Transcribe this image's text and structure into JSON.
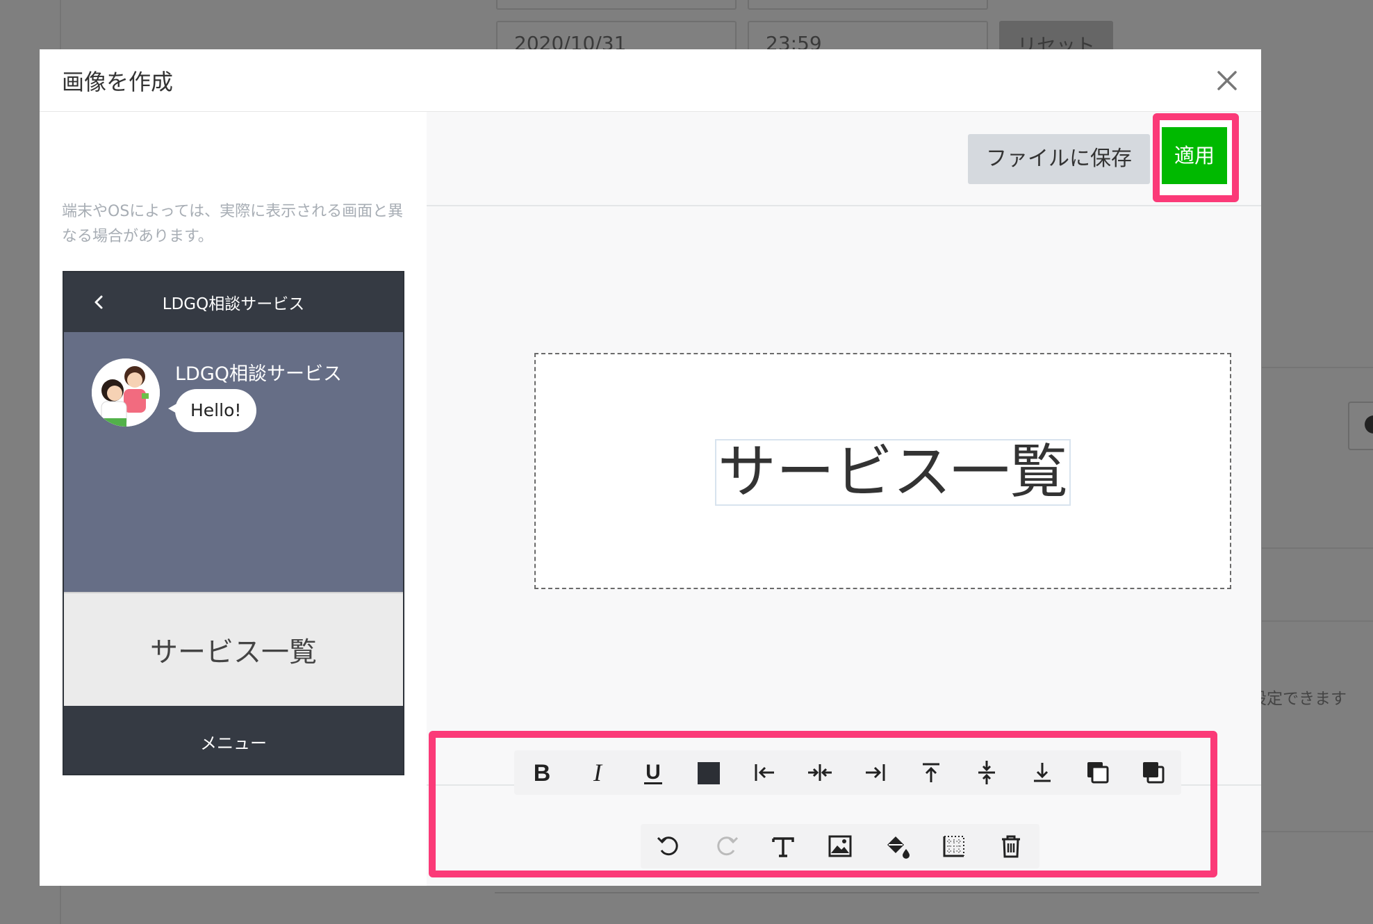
{
  "background": {
    "date_value": "2020/10/31",
    "time_value": "23:59",
    "reset_label": "リセット",
    "side_text": "設定できます"
  },
  "modal": {
    "title": "画像を作成",
    "preview_note": "端末やOSによっては、実際に表示される画面と異なる場合があります。",
    "phone": {
      "header_title": "LDGQ相談サービス",
      "chat_name": "LDGQ相談サービス",
      "message": "Hello!",
      "rich_menu_text": "サービス一覧",
      "menu_label": "メニュー"
    },
    "buttons": {
      "save_file": "ファイルに保存",
      "apply": "適用"
    },
    "canvas": {
      "text": "サービス一覧"
    },
    "toolbar": {
      "row1": [
        "bold-icon",
        "italic-icon",
        "underline-icon",
        "text-color-icon",
        "align-left-icon",
        "align-center-icon",
        "align-right-icon",
        "align-top-icon",
        "align-middle-icon",
        "align-bottom-icon",
        "bring-front-icon",
        "send-back-icon"
      ],
      "row2": [
        "undo-icon",
        "redo-icon",
        "add-text-icon",
        "add-image-icon",
        "fill-color-icon",
        "grid-icon",
        "delete-icon"
      ]
    }
  },
  "colors": {
    "accent_green": "#00b900",
    "highlight_pink": "#fb3a78",
    "phone_dark": "#353a43",
    "phone_chat_bg": "#666e86"
  }
}
